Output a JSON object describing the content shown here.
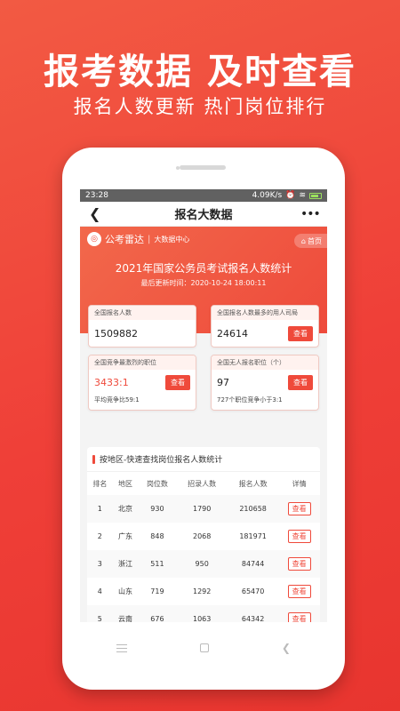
{
  "hero": {
    "title": "报考数据 及时查看",
    "subtitle": "报名人数更新 热门岗位排行"
  },
  "status_bar": {
    "time": "23:28",
    "network": "4.09K/s"
  },
  "nav": {
    "back_icon": "back-chevron-icon",
    "title": "报名大数据",
    "more_icon": "more-dots-icon"
  },
  "banner": {
    "brand_name": "公考雷达",
    "brand_separator": "|",
    "brand_sub": "大数据中心",
    "home_label": "首页",
    "title": "2021年国家公务员考试报名人数统计",
    "updated": "最后更新时间：2020-10-24 18:00:11"
  },
  "cards": {
    "total_applicants": {
      "label": "全国报名人数",
      "value": "1509882"
    },
    "max_department": {
      "label": "全国报名人数最多的用人司局",
      "value": "24614",
      "button": "查看"
    },
    "fiercest_position": {
      "label": "全国竞争最激烈的职位",
      "value": "3433:1",
      "button": "查看",
      "note": "平均竞争比59:1"
    },
    "no_applicant_positions": {
      "label": "全国无人报名职位（个）",
      "value": "97",
      "button": "查看",
      "note": "727个职位竞争小于3:1"
    }
  },
  "region_section": {
    "title": "按地区-快速查找岗位报名人数统计",
    "columns": [
      "排名",
      "地区",
      "岗位数",
      "招录人数",
      "报名人数",
      "详情"
    ],
    "rows": [
      {
        "rank": "1",
        "region": "北京",
        "positions": "930",
        "recruits": "1790",
        "applicants": "210658",
        "action": "查看"
      },
      {
        "rank": "2",
        "region": "广东",
        "positions": "848",
        "recruits": "2068",
        "applicants": "181971",
        "action": "查看"
      },
      {
        "rank": "3",
        "region": "浙江",
        "positions": "511",
        "recruits": "950",
        "applicants": "84744",
        "action": "查看"
      },
      {
        "rank": "4",
        "region": "山东",
        "positions": "719",
        "recruits": "1292",
        "applicants": "65470",
        "action": "查看"
      },
      {
        "rank": "5",
        "region": "云南",
        "positions": "676",
        "recruits": "1063",
        "applicants": "64342",
        "action": "查看"
      }
    ]
  },
  "colors": {
    "accent": "#ef4a3b",
    "background": "#f25a43"
  }
}
